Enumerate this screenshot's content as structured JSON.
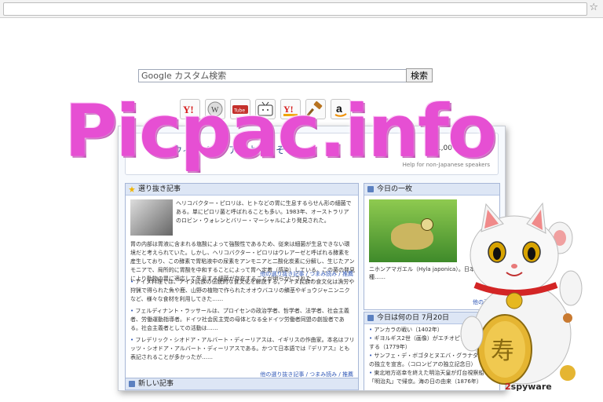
{
  "search": {
    "placeholder": "Google カスタム検索",
    "button_label": "検索"
  },
  "icons": [
    "yahoo-icon",
    "wikipedia-icon",
    "youtube-icon",
    "niconico-icon",
    "yahoo-auctions-icon",
    "hammer-icon",
    "amazon-icon"
  ],
  "wiki": {
    "title": "ウィキペディアへようこそ",
    "stat": "1,00",
    "help": "Help for non-Japanese speakers",
    "featured": {
      "header": "選り抜き記事",
      "text": "ヘリコバクター・ピロリは、ヒトなどの胃に生息するらせん形の細菌である。単にピロリ菌と呼ばれることも多い。1983年、オーストラリアのロビン・ウォレンとバリー・マーシャルにより発見された。",
      "text2": "胃の内部は胃液に含まれる塩酸によって強酸性であるため、従来は細菌が生息できない環境だと考えられていた。しかし、ヘリコバクター・ピロリはウレアーゼと呼ばれる酵素を産生しており、この酵素で胃粘液中の尿素をアンモニアと二酸化炭素に分解し、生じたアンモニアで、局所的に胃酸を中和することによって胃へ定着（感染）している。この菌の発見により動物の胃に適応して生息する細菌が存在することが明らかにされた。",
      "more": "他の選り抜き記事 / つまみ読み / 推薦",
      "news": [
        "アイヌ料理では、アイヌ民族の伝統的な食文化を解説する。アイヌ民族の食文化は漁労や狩猟で得られた魚や鹿、山野の植物で作られたオオウバユリの鱗茎やギョウジャニンニクなど、様々な食材を利用してきた……",
        "フェルディナント・ラッサールは、プロイセンの政治学者、哲学者、法学者、社会主義者、労働運動指導者。ドイツ社会民主党の母体となる全ドイツ労働者同盟の創設者である。社会主義者としての活動は……",
        "フレデリック・シオドア・アルバート・ディーリアスは、イギリスの作曲家。本名はフリッツ・シオドア・アルバート・ディーリアスである。かつて日本語では『デリアス』とも表記されることが多かったが……"
      ],
      "more2": "他の選り抜き記事 / つまみ読み / 推薦",
      "new_articles_header": "新しい記事"
    },
    "photo": {
      "header": "今日の一枚",
      "caption": "ニホンアマガエル（Hyla japonica）。日本の固有種……",
      "more": "他の画像"
    },
    "today": {
      "header": "今日は何の日 7月20日",
      "items": [
        "アンカラの戦い（1402年）",
        "ギヨルギス2世（画像）がエチオピア皇帝に即位する（1779年）",
        "サンフェ・デ・ボゴタとヌエバ・グラナダからの独立を宣言。（コロンビアの独立記念日）",
        "東北地方巡幸を終えた明治天皇が灯台視察船「明治丸」で帰京。海の日の由来（1876年）"
      ]
    }
  },
  "watermark": "Picpac.info",
  "logo": {
    "digit": "2",
    "rest": "spyware"
  }
}
